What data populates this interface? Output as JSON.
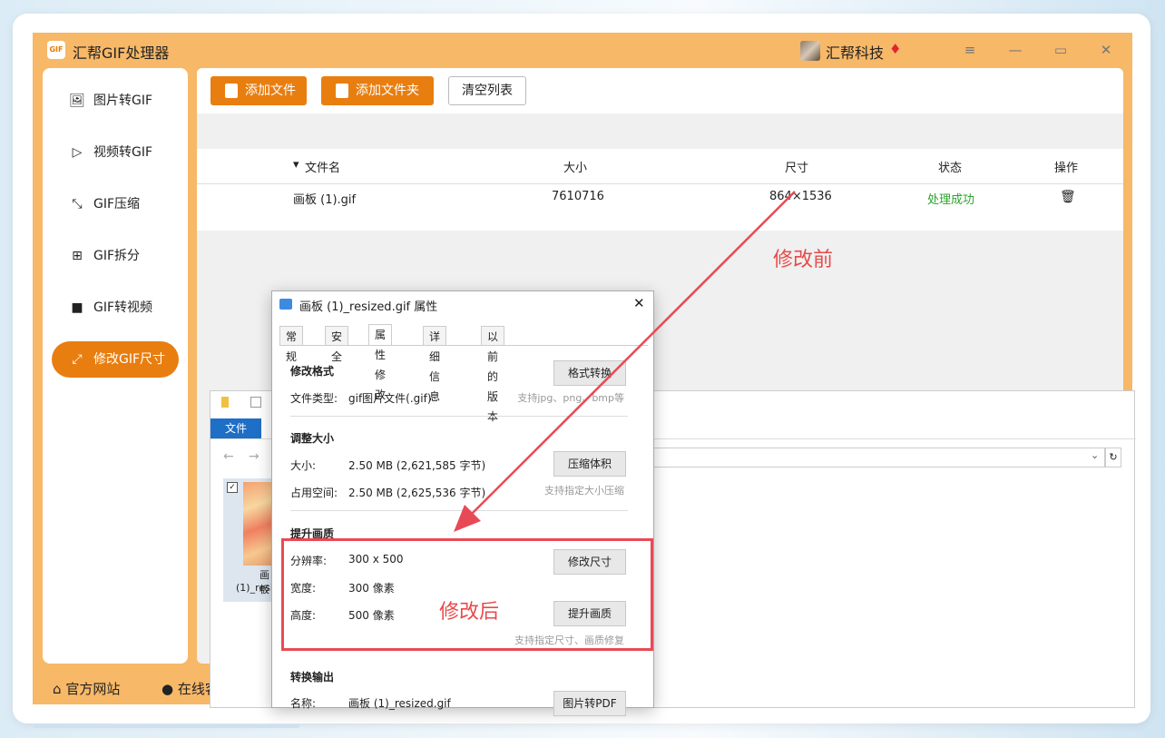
{
  "app": {
    "logo_text": "GIF",
    "title": "汇帮GIF处理器",
    "company": "汇帮科技",
    "window_buttons": [
      "menu-icon",
      "minimize-icon",
      "maximize-icon",
      "close-icon"
    ]
  },
  "sidebar": {
    "items": [
      {
        "label": "图片转GIF",
        "icon": "image-icon"
      },
      {
        "label": "视频转GIF",
        "icon": "play-icon"
      },
      {
        "label": "GIF压缩",
        "icon": "compress-icon"
      },
      {
        "label": "GIF拆分",
        "icon": "split-icon"
      },
      {
        "label": "GIF转视频",
        "icon": "video-icon"
      },
      {
        "label": "修改GIF尺寸",
        "icon": "resize-icon",
        "active": true
      }
    ],
    "bottom": {
      "website": "官方网站",
      "online": "在线客"
    }
  },
  "toolbar": {
    "add_file": "添加文件",
    "add_folder": "添加文件夹",
    "clear_list": "清空列表"
  },
  "table": {
    "headers": {
      "name": "文件名",
      "size": "大小",
      "dims": "尺寸",
      "status": "状态",
      "action": "操作"
    },
    "rows": [
      {
        "name": "画板 (1).gif",
        "size": "7610716",
        "dims": "864×1536",
        "status": "处理成功"
      }
    ]
  },
  "annotations": {
    "before": "修改前",
    "after": "修改后"
  },
  "explorer": {
    "file_tab": "文件",
    "item_label_1": "画板",
    "item_label_2": "(1)_resi"
  },
  "dialog": {
    "title": "画板 (1)_resized.gif 属性",
    "tabs": [
      "常规",
      "安全",
      "属性修改",
      "详细信息",
      "以前的版本"
    ],
    "sec_format": "修改格式",
    "filetype_label": "文件类型:",
    "filetype_value": "gif图片文件(.gif)",
    "btn_format": "格式转换",
    "hint_format": "支持jpg、png、bmp等",
    "sec_size": "调整大小",
    "size_label": "大小:",
    "size_value": "2.50 MB (2,621,585 字节)",
    "space_label": "占用空间:",
    "space_value": "2.50 MB (2,625,536 字节)",
    "btn_compress": "压缩体积",
    "hint_compress": "支持指定大小压缩",
    "sec_quality": "提升画质",
    "res_label": "分辨率:",
    "res_value": "300 x 500",
    "width_label": "宽度:",
    "width_value": "300 像素",
    "height_label": "高度:",
    "height_value": "500 像素",
    "btn_resize": "修改尺寸",
    "btn_quality": "提升画质",
    "hint_quality": "支持指定尺寸、画质修复",
    "sec_output": "转换输出",
    "name_label": "名称:",
    "name_value": "画板 (1)_resized.gif",
    "btn_pdf": "图片转PDF"
  },
  "colors": {
    "accent": "#e87e10",
    "frame": "#f7b868",
    "success": "#2aa52a",
    "annotation": "#e84a4a"
  }
}
